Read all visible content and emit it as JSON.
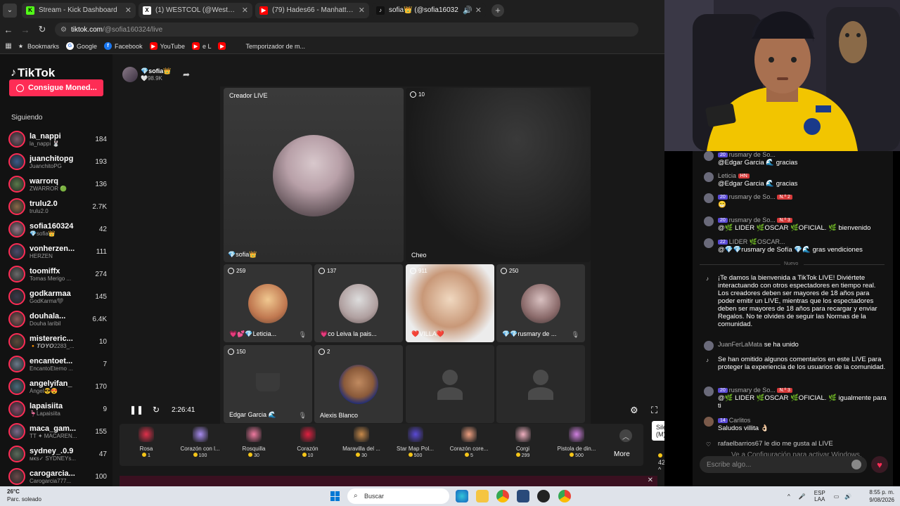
{
  "browser": {
    "tabs": [
      {
        "title": "Stream - Kick Dashboard",
        "fav": "K",
        "color": "#53fc18"
      },
      {
        "title": "(1) WESTCOL (@WestCOL) / X",
        "fav": "X",
        "color": "#ffffff"
      },
      {
        "title": "(79) Hades66 - Manhattan II X",
        "fav": "▶",
        "color": "#ff0000"
      },
      {
        "title": "sofia👑 (@sofia16032",
        "fav": "♪",
        "color": "#111111"
      }
    ],
    "url_host": "tiktok.com",
    "url_path": "/@sofia160324/live",
    "bookmarks": [
      {
        "label": "Bookmarks",
        "icon": "star-icon"
      },
      {
        "label": "Google",
        "icon": "google-icon"
      },
      {
        "label": "Facebook",
        "icon": "facebook-icon"
      },
      {
        "label": "YouTube",
        "icon": "youtube-icon"
      },
      {
        "label": "e L",
        "icon": "youtube-icon"
      },
      {
        "label": "",
        "icon": "youtube-icon"
      },
      {
        "label": "Temporizador de m...",
        "icon": ""
      }
    ]
  },
  "sidebar": {
    "logo": "TikTok",
    "coins_button": "Consigue Moned...",
    "following_header": "Siguiendo",
    "items": [
      {
        "name": "la_nappi",
        "sub": "la_nappi 🐰",
        "count": "184"
      },
      {
        "name": "juanchitopg",
        "sub": "JuanchitoPG",
        "count": "193"
      },
      {
        "name": "warrorq",
        "sub": "ZWARROR 🟢",
        "count": "136"
      },
      {
        "name": "trulu2.0",
        "sub": "trulu2.0",
        "count": "2.7K"
      },
      {
        "name": "sofia160324",
        "sub": "💎sofia👑",
        "count": "42"
      },
      {
        "name": "vonherzen...",
        "sub": "HERZEN",
        "count": "111"
      },
      {
        "name": "toomiffx",
        "sub": "Tomas Merigo ...",
        "count": "274"
      },
      {
        "name": "godkarmaa",
        "sub": "GodKarma🖤",
        "count": "145"
      },
      {
        "name": "douhala...",
        "sub": "Douha laribil",
        "count": "6.4K"
      },
      {
        "name": "mistereric...",
        "sub": "🔸𝙏𝙊𝙔𝙊2283_...",
        "count": "10"
      },
      {
        "name": "encantoet...",
        "sub": "EncantoEterno ...",
        "count": "7"
      },
      {
        "name": "angelyifan_",
        "sub": "Ángel😎😍",
        "count": "170"
      },
      {
        "name": "lapaisiita",
        "sub": "🦩Lapaisiita",
        "count": "9"
      },
      {
        "name": "maca_gam...",
        "sub": "TT ✦ MACAREN...",
        "count": "155"
      },
      {
        "name": "sydney_.0.9",
        "sub": "ᴍᴋs✓ SYDNEYs...",
        "count": "47"
      },
      {
        "name": "carogarcia...",
        "sub": "Carogarcia777...",
        "count": "100"
      }
    ]
  },
  "live": {
    "host_name": "💎sofia👑",
    "host_likes": "🤍98.9K",
    "host_tile_label": "Creador LIVE",
    "host_tile_name": "💎sofia👑",
    "tile2_viewers": "10",
    "tile2_name": "Cheo",
    "guests": [
      {
        "viewers": "259",
        "name": "💗💕💎Leticia..."
      },
      {
        "viewers": "137",
        "name": "💗co Leiva la pais..."
      },
      {
        "viewers": "911",
        "name": "❤️VILLA❤️"
      },
      {
        "viewers": "250",
        "name": "💎💎rusmary de ..."
      },
      {
        "viewers": "150",
        "name": "Edgar Garcia 🌊"
      },
      {
        "viewers": "2",
        "name": "Alexis Blanco"
      }
    ],
    "elapsed": "2:26:41",
    "tooltip": "Silenciar (M)",
    "volume_level": 0.15
  },
  "gifts": [
    {
      "name": "Rosa",
      "price": "1",
      "color": "#e0304a"
    },
    {
      "name": "Corazón con l...",
      "price": "100",
      "color": "#a88cf0"
    },
    {
      "name": "Rosquilla",
      "price": "30",
      "color": "#f07aa0"
    },
    {
      "name": "Corazón",
      "price": "10",
      "color": "#e02040"
    },
    {
      "name": "Maravilla del ...",
      "price": "30",
      "color": "#c88a4a"
    },
    {
      "name": "Star Map Pol...",
      "price": "500",
      "color": "#5a4ad6"
    },
    {
      "name": "Corazón core...",
      "price": "5",
      "color": "#f0a080"
    },
    {
      "name": "Corgi",
      "price": "299",
      "color": "#f0b0c0"
    },
    {
      "name": "Pistola de din...",
      "price": "500",
      "color": "#d080e0"
    }
  ],
  "gift_more": "More",
  "coin_total": "421",
  "chat": {
    "messages": [
      {
        "user": "rusmary de So...",
        "text": "@Edgar Garcia 🌊 gracias",
        "badge": "20"
      },
      {
        "user": "Leticia",
        "text": "@Edgar Garcia 🌊 gracias",
        "badge": ""
      },
      {
        "user": "rusmary de So...",
        "text": "😁",
        "badge": "20"
      },
      {
        "user": "rusmary de So...",
        "text": "@🌿 LIDER 🌿OSCAR 🌿OFICIAL. 🌿 bienvenido",
        "badge": "20"
      },
      {
        "user": "LIDER 🌿OSCAR...",
        "text": "@💎💎rusmary de Sofía 💎🌊 gras vendiciones",
        "badge": "22"
      }
    ],
    "nuevo": "Nuevo",
    "welcome": "¡Te damos la bienvenida a TikTok LIVE! Diviértete interactuando con otros espectadores en tiempo real. Los creadores deben ser mayores de 18 años para poder emitir un LIVE, mientras que los espectadores deben ser mayores de 18 años para recargar y enviar Regalos. No te olvides de seguir las Normas de la comunidad.",
    "joined_user": "JuanFerLaMata",
    "joined_text": "se ha unido",
    "omitted": "Se han omitido algunos comentarios en este LIVE para proteger la experiencia de los usuarios de la comunidad.",
    "msg6_user": "rusmary de So...",
    "msg6_text": "@🌿 LIDER 🌿OSCAR 🌿OFICIAL. 🌿 igualmente para ti",
    "msg7_user": "Carlitos",
    "msg7_text": "Saludos villita 👌🏻",
    "like_text": "rafaelbarrios67 le dio me gusta al LIVE",
    "input_placeholder": "Escribe algo...",
    "watermark": "Ve a Configuración para activar Windows."
  },
  "taskbar": {
    "temp": "26°C",
    "weather": "Parc. soleado",
    "search": "Buscar",
    "lang": "ESP\nLAA",
    "time": "8:55 p. m.",
    "date": "9/08/2026"
  }
}
